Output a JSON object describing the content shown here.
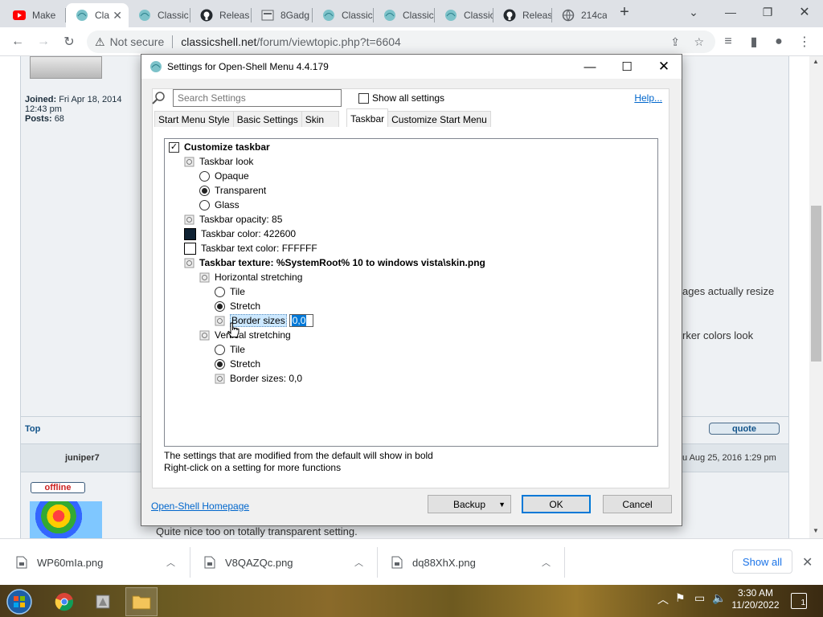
{
  "browser": {
    "tabs": [
      {
        "title": "Make",
        "icon": "youtube-icon",
        "active": false
      },
      {
        "title": "Cla",
        "icon": "shell-icon",
        "active": true
      },
      {
        "title": "Classic",
        "icon": "shell-icon",
        "active": false
      },
      {
        "title": "Releas",
        "icon": "github-icon",
        "active": false
      },
      {
        "title": "8Gadg",
        "icon": "page-icon",
        "active": false
      },
      {
        "title": "Classic",
        "icon": "shell-icon",
        "active": false
      },
      {
        "title": "Classic",
        "icon": "shell-icon",
        "active": false
      },
      {
        "title": "Classic",
        "icon": "shell-icon",
        "active": false
      },
      {
        "title": "Releas",
        "icon": "github-icon",
        "active": false
      },
      {
        "title": "214ca",
        "icon": "globe-icon",
        "active": false
      }
    ],
    "address": {
      "security": "Not secure",
      "domain": "classicshell.net",
      "path": "/forum/viewtopic.php?t=6604"
    }
  },
  "forum": {
    "joined_label": "Joined:",
    "joined_value": "Fri Apr 18, 2014",
    "joined_time": "12:43 pm",
    "posts_label": "Posts:",
    "posts_value": "68",
    "side_text_1": "ages actually resize",
    "side_text_2": "rker colors look",
    "top_link": "Top",
    "quote_label": "quote",
    "author": "juniper7",
    "post_date": "u Aug 25, 2016 1:29 pm",
    "status": "offline",
    "post_text": "Quite nice too on totally transparent setting."
  },
  "dialog": {
    "title": "Settings for Open-Shell Menu 4.4.179",
    "search_placeholder": "Search Settings",
    "show_all_label": "Show all settings",
    "help_label": "Help...",
    "tabs": [
      "Start Menu Style",
      "Basic Settings",
      "Skin",
      "Taskbar",
      "Customize Start Menu"
    ],
    "active_tab": "Taskbar",
    "tree": {
      "customize_taskbar": "Customize taskbar",
      "taskbar_look": "Taskbar look",
      "opaque": "Opaque",
      "transparent": "Transparent",
      "glass": "Glass",
      "opacity": "Taskbar opacity: 85",
      "color": "Taskbar color: 422600",
      "color_hex": "#0f2233",
      "text_color": "Taskbar text color: FFFFFF",
      "text_color_hex": "#ffffff",
      "texture": "Taskbar texture: %SystemRoot% 10 to windows vista\\skin.png",
      "h_stretching": "Horizontal stretching",
      "h_tile": "Tile",
      "h_stretch": "Stretch",
      "h_border_label": "Border sizes",
      "h_border_value": "0,0",
      "v_stretching": "Vertical stretching",
      "v_tile": "Tile",
      "v_stretch": "Stretch",
      "v_border": "Border sizes: 0,0"
    },
    "note_1": "The settings that are modified from the default will show in bold",
    "note_2": "Right-click on a setting for more functions",
    "homepage_link": "Open-Shell Homepage",
    "backup_label": "Backup",
    "ok_label": "OK",
    "cancel_label": "Cancel"
  },
  "downloads": {
    "items": [
      "WP60mIa.png",
      "V8QAZQc.png",
      "dq88XhX.png"
    ],
    "show_all": "Show all"
  },
  "taskbar": {
    "time": "3:30 AM",
    "date": "11/20/2022",
    "notification_count": "1"
  }
}
